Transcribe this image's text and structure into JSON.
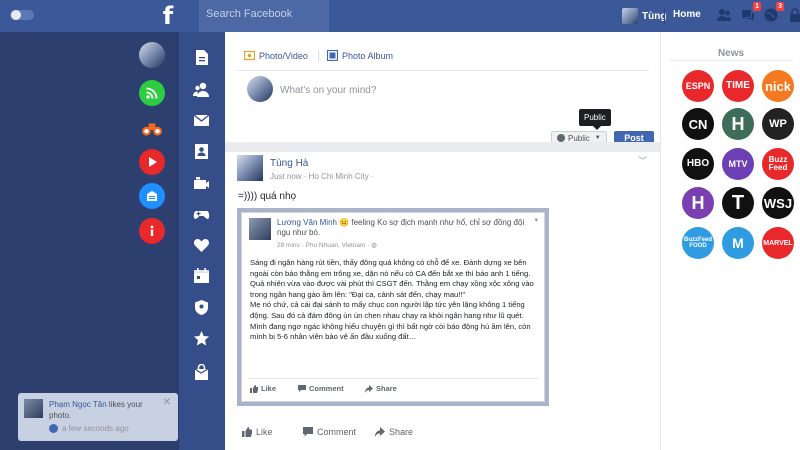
{
  "topbar": {
    "search_placeholder": "Search Facebook",
    "user_name": "Tùng",
    "home_label": "Home",
    "badges": {
      "messages": "1",
      "notifications": "3"
    },
    "colors": {
      "bar": "#3b5998"
    }
  },
  "left_apps": [
    {
      "name": "profile-avatar",
      "icon": "avatar"
    },
    {
      "name": "feed-app",
      "icon": "rss-icon",
      "color": "#2ecc40"
    },
    {
      "name": "binoculars-app",
      "icon": "binoculars-icon",
      "color": "#f26b21"
    },
    {
      "name": "video-app",
      "icon": "play-icon",
      "color": "#e8282b"
    },
    {
      "name": "pages-app",
      "icon": "building-icon",
      "color": "#1e90ff"
    },
    {
      "name": "info-app",
      "icon": "info-icon",
      "color": "#e8282b"
    }
  ],
  "sidebar_icons": [
    "document-icon",
    "friends-icon",
    "mail-icon",
    "contacts-icon",
    "camera-icon",
    "gamepad-icon",
    "heart-icon",
    "calendar-icon",
    "shield-icon",
    "star-icon",
    "bag-icon"
  ],
  "toast": {
    "actor": "Phạm Ngọc Tân",
    "text": " likes your photo.",
    "time": "a few seconds ago"
  },
  "composer": {
    "tab_photo_video": "Photo/Video",
    "tab_photo_album": "Photo Album",
    "placeholder": "What's on your mind?",
    "tooltip": "Public",
    "audience": "Public",
    "post_label": "Post"
  },
  "post": {
    "author": "Tùng Hà",
    "meta": "Just now · Ho Chi Minh City ·",
    "text": "=)))) quá nhọ",
    "shared_image": {
      "author": "Lương Văn Minh",
      "feeling": " 😐 feeling Ko sợ địch mạnh như hổ, chỉ sợ đồng đội ngu như bò.",
      "meta": "28 mins · Phu Nhuan, Vietnam · ",
      "body": [
        "Sáng đi ngân hàng rút tiền, thấy đông quá không có chỗ để xe. Đành dựng xe bên ngoài còn bảo thằng em trông xe, dặn nó nếu có CA đến bắt xe thì báo anh 1 tiếng.",
        "Quả nhiên vừa vào được vài phút thì CSGT đến. Thằng em chạy xồng xộc xông vào trong ngân hang gào ầm lên: \"Đại ca, cảnh sát đến, chạy mau!!\"",
        "Mẹ nó chứ, cả cái đại sảnh to mấy chục con người lập tức yên lặng không 1 tiếng động. Sau đó cả đám đông ùn ùn chen nhau chạy ra khỏi ngân hang như lũ quét.",
        "Mình đang ngơ ngác không hiểu chuyện gì thì bất ngờ còi báo động hú ầm lên, còn mình bị 5-6 nhân viên bảo vệ ấn đầu xuống đất…"
      ],
      "like": "Like",
      "comment": "Comment",
      "share": "Share"
    },
    "actions": {
      "like": "Like",
      "comment": "Comment",
      "share": "Share"
    }
  },
  "news": {
    "title": "News",
    "outlets": [
      {
        "label": "ESPN",
        "color": "#e8282b",
        "text_color": "#ffffff"
      },
      {
        "label": "TIME",
        "color": "#e8282b",
        "text_color": "#ffffff"
      },
      {
        "label": "nick",
        "color": "#f57a1f",
        "text_color": "#ffffff"
      },
      {
        "label": "CN",
        "color": "#111111",
        "text_color": "#ffffff"
      },
      {
        "label": "H",
        "color": "#3f6d5b",
        "text_color": "#ffffff"
      },
      {
        "label": "WP",
        "color": "#222222",
        "text_color": "#ffffff"
      },
      {
        "label": "HBO",
        "color": "#111111",
        "text_color": "#ffffff"
      },
      {
        "label": "MTV",
        "color": "#6d3fb5",
        "text_color": "#ffffff"
      },
      {
        "label": "Buzz Feed",
        "color": "#e8282b",
        "text_color": "#ffffff"
      },
      {
        "label": "H",
        "color": "#7a3fb0",
        "text_color": "#ffffff"
      },
      {
        "label": "T",
        "color": "#111111",
        "text_color": "#ffffff"
      },
      {
        "label": "WSJ",
        "color": "#111111",
        "text_color": "#ffffff"
      },
      {
        "label": "BuzzFeed FOOD",
        "color": "#2f9be0",
        "text_color": "#ffffff"
      },
      {
        "label": "M",
        "color": "#2f9be0",
        "text_color": "#ffffff"
      },
      {
        "label": "MARVEL",
        "color": "#e8282b",
        "text_color": "#ffffff"
      }
    ]
  }
}
